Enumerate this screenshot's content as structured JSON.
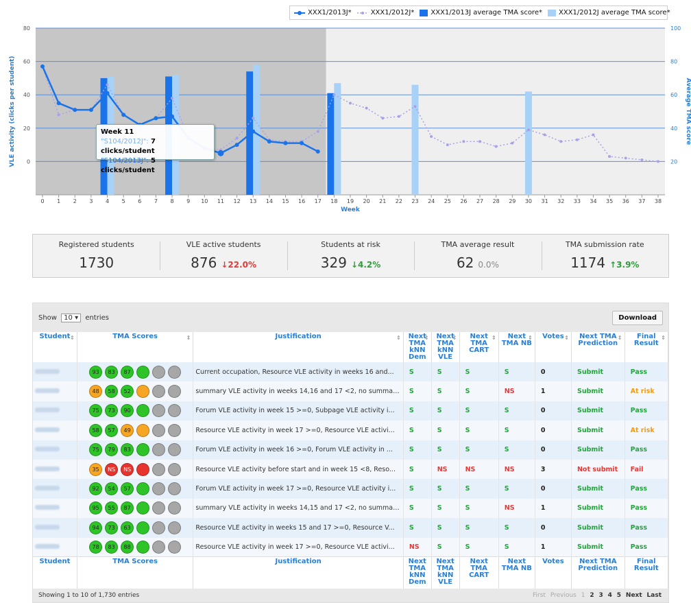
{
  "legend": [
    {
      "label": "XXX1/2013J*",
      "kind": "line-solid",
      "color": "#1a73e8"
    },
    {
      "label": "XXX1/2012J*",
      "kind": "line-dot",
      "color": "#a7a2e8"
    },
    {
      "label": "XXX1/2013J average TMA score*",
      "kind": "bar",
      "color": "#1a73e8"
    },
    {
      "label": "XXX1/2012J average TMA score*",
      "kind": "bar",
      "color": "#a8d1f7"
    }
  ],
  "tooltip": {
    "title": "Week 11",
    "line1_series": "\"S104/2012J\":",
    "line1_value": "7 clicks/student",
    "line2_series": "\"S104/2013J\":",
    "line2_value": "5 clicks/student"
  },
  "chart_data": {
    "type": "line",
    "xlabel": "Week",
    "ylabel": "VLE activity (clicks per student)",
    "y2label": "Average TMA score",
    "x": [
      0,
      1,
      2,
      3,
      4,
      5,
      6,
      7,
      8,
      9,
      10,
      11,
      12,
      13,
      14,
      15,
      16,
      17,
      18,
      19,
      20,
      21,
      22,
      23,
      24,
      25,
      26,
      27,
      28,
      29,
      30,
      31,
      32,
      33,
      34,
      35,
      36,
      37,
      38
    ],
    "ylim": [
      -20,
      80
    ],
    "y_ticks": [
      0,
      20,
      40,
      60,
      80
    ],
    "y2lim": [
      0,
      100
    ],
    "y2_ticks": [
      20,
      40,
      60,
      80,
      100
    ],
    "shaded_until_week": 17,
    "series": [
      {
        "name": "XXX1/2013J*",
        "style": "solid",
        "x": [
          0,
          1,
          2,
          3,
          4,
          5,
          6,
          7,
          8,
          9,
          10,
          11,
          12,
          13,
          14,
          15,
          16,
          17
        ],
        "values": [
          57,
          35,
          31,
          31,
          41,
          28,
          22,
          26,
          27,
          14,
          8,
          5,
          10,
          18,
          12,
          11,
          11,
          6
        ]
      },
      {
        "name": "XXX1/2012J*",
        "style": "dotted",
        "x": [
          0,
          1,
          2,
          3,
          4,
          5,
          6,
          7,
          8,
          9,
          10,
          11,
          12,
          13,
          14,
          15,
          16,
          17,
          18,
          19,
          20,
          21,
          22,
          23,
          24,
          25,
          26,
          27,
          28,
          29,
          30,
          31,
          32,
          33,
          34,
          35,
          36,
          37,
          38
        ],
        "values": [
          57,
          28,
          31,
          31,
          46,
          28,
          22,
          26,
          38,
          15,
          8,
          7,
          14,
          26,
          13,
          12,
          12,
          18,
          40,
          35,
          32,
          26,
          27,
          33,
          15,
          10,
          12,
          12,
          9,
          11,
          19,
          16,
          12,
          13,
          16,
          3,
          2,
          1,
          0
        ]
      }
    ],
    "bars": [
      {
        "name": "XXX1/2013J average TMA score*",
        "weeks": [
          4,
          8,
          13,
          18
        ],
        "values": [
          70,
          71,
          74,
          61
        ]
      },
      {
        "name": "XXX1/2012J average TMA score*",
        "weeks": [
          4,
          8,
          13,
          18,
          23,
          30
        ],
        "values": [
          71,
          72,
          78,
          67,
          66,
          62
        ]
      }
    ]
  },
  "stats": [
    {
      "label": "Registered students",
      "value": "1730",
      "change": "",
      "dir": "none"
    },
    {
      "label": "VLE active students",
      "value": "876",
      "change": "22.0%",
      "dir": "down"
    },
    {
      "label": "Students at risk",
      "value": "329",
      "change": "4.2%",
      "dir": "down-good"
    },
    {
      "label": "TMA average result",
      "value": "62",
      "change": "0.0%",
      "dir": "flat"
    },
    {
      "label": "TMA submission rate",
      "value": "1174",
      "change": "3.9%",
      "dir": "up"
    }
  ],
  "table": {
    "show_label": "Show",
    "show_value": "10",
    "entries_label": "entries",
    "download_label": "Download",
    "headers": [
      "Student",
      "TMA Scores",
      "Justification",
      "Next TMA kNN Dem",
      "Next TMA kNN VLE",
      "Next TMA CART",
      "Next TMA NB",
      "Votes",
      "Next TMA Prediction",
      "Final Result"
    ],
    "rows": [
      {
        "scores": [
          [
            "93",
            "g"
          ],
          [
            "83",
            "g"
          ],
          [
            "87",
            "g"
          ],
          [
            "",
            "g"
          ],
          [
            "",
            "x"
          ],
          [
            "",
            "x"
          ]
        ],
        "just": "Current occupation, Resource VLE activity in weeks 16 and...",
        "p": [
          "S",
          "S",
          "S",
          "S"
        ],
        "votes": "0",
        "pred": "Submit",
        "pc": "S",
        "final": "Pass",
        "fc": "S"
      },
      {
        "scores": [
          [
            "48",
            "o"
          ],
          [
            "58",
            "g"
          ],
          [
            "52",
            "g"
          ],
          [
            "",
            "o"
          ],
          [
            "",
            "x"
          ],
          [
            "",
            "x"
          ]
        ],
        "just": "summary VLE activity in weeks 14,16 and 17 <2, no summar...",
        "p": [
          "S",
          "S",
          "S",
          "NS"
        ],
        "votes": "1",
        "pred": "Submit",
        "pc": "S",
        "final": "At risk",
        "fc": "O"
      },
      {
        "scores": [
          [
            "75",
            "g"
          ],
          [
            "73",
            "g"
          ],
          [
            "90",
            "g"
          ],
          [
            "",
            "g"
          ],
          [
            "",
            "x"
          ],
          [
            "",
            "x"
          ]
        ],
        "just": "Forum VLE activity in week 15 >=0, Subpage VLE activity i...",
        "p": [
          "S",
          "S",
          "S",
          "S"
        ],
        "votes": "0",
        "pred": "Submit",
        "pc": "S",
        "final": "Pass",
        "fc": "S"
      },
      {
        "scores": [
          [
            "58",
            "g"
          ],
          [
            "57",
            "g"
          ],
          [
            "49",
            "o"
          ],
          [
            "",
            "o"
          ],
          [
            "",
            "x"
          ],
          [
            "",
            "x"
          ]
        ],
        "just": "Resource VLE activity in week 17 >=0, Resource VLE activi...",
        "p": [
          "S",
          "S",
          "S",
          "S"
        ],
        "votes": "0",
        "pred": "Submit",
        "pc": "S",
        "final": "At risk",
        "fc": "O"
      },
      {
        "scores": [
          [
            "75",
            "g"
          ],
          [
            "79",
            "g"
          ],
          [
            "83",
            "g"
          ],
          [
            "",
            "g"
          ],
          [
            "",
            "x"
          ],
          [
            "",
            "x"
          ]
        ],
        "just": "Forum VLE activity in week 16 >=0, Forum VLE activity in ...",
        "p": [
          "S",
          "S",
          "S",
          "S"
        ],
        "votes": "0",
        "pred": "Submit",
        "pc": "S",
        "final": "Pass",
        "fc": "S"
      },
      {
        "scores": [
          [
            "35",
            "o"
          ],
          [
            "NS",
            "r"
          ],
          [
            "NS",
            "r"
          ],
          [
            "",
            "r"
          ],
          [
            "",
            "x"
          ],
          [
            "",
            "x"
          ]
        ],
        "just": "Resource VLE activity before start and in week 15 <8, Reso...",
        "p": [
          "S",
          "NS",
          "NS",
          "NS"
        ],
        "votes": "3",
        "pred": "Not submit",
        "pc": "NS",
        "final": "Fail",
        "fc": "NS"
      },
      {
        "scores": [
          [
            "92",
            "g"
          ],
          [
            "54",
            "g"
          ],
          [
            "57",
            "g"
          ],
          [
            "",
            "g"
          ],
          [
            "",
            "x"
          ],
          [
            "",
            "x"
          ]
        ],
        "just": "Forum VLE activity in week 17 >=0, Resource VLE activity i...",
        "p": [
          "S",
          "S",
          "S",
          "S"
        ],
        "votes": "0",
        "pred": "Submit",
        "pc": "S",
        "final": "Pass",
        "fc": "S"
      },
      {
        "scores": [
          [
            "95",
            "g"
          ],
          [
            "55",
            "g"
          ],
          [
            "87",
            "g"
          ],
          [
            "",
            "g"
          ],
          [
            "",
            "x"
          ],
          [
            "",
            "x"
          ]
        ],
        "just": "summary VLE activity in weeks 14,15 and 17 <2, no summar...",
        "p": [
          "S",
          "S",
          "S",
          "NS"
        ],
        "votes": "1",
        "pred": "Submit",
        "pc": "S",
        "final": "Pass",
        "fc": "S"
      },
      {
        "scores": [
          [
            "94",
            "g"
          ],
          [
            "73",
            "g"
          ],
          [
            "63",
            "g"
          ],
          [
            "",
            "g"
          ],
          [
            "",
            "x"
          ],
          [
            "",
            "x"
          ]
        ],
        "just": "Resource VLE activity in weeks 15 and 17 >=0, Resource V...",
        "p": [
          "S",
          "S",
          "S",
          "S"
        ],
        "votes": "0",
        "pred": "Submit",
        "pc": "S",
        "final": "Pass",
        "fc": "S"
      },
      {
        "scores": [
          [
            "78",
            "g"
          ],
          [
            "83",
            "g"
          ],
          [
            "88",
            "g"
          ],
          [
            "",
            "g"
          ],
          [
            "",
            "x"
          ],
          [
            "",
            "x"
          ]
        ],
        "just": "Resource VLE activity in week 17 >=0, Resource VLE activi...",
        "p": [
          "NS",
          "S",
          "S",
          "S"
        ],
        "votes": "1",
        "pred": "Submit",
        "pc": "S",
        "final": "Pass",
        "fc": "S"
      }
    ],
    "info": "Showing 1 to 10 of 1,730 entries",
    "pager": {
      "first": "First",
      "previous": "Previous",
      "pages": [
        "1",
        "2",
        "3",
        "4",
        "5"
      ],
      "next": "Next",
      "last": "Last"
    }
  }
}
